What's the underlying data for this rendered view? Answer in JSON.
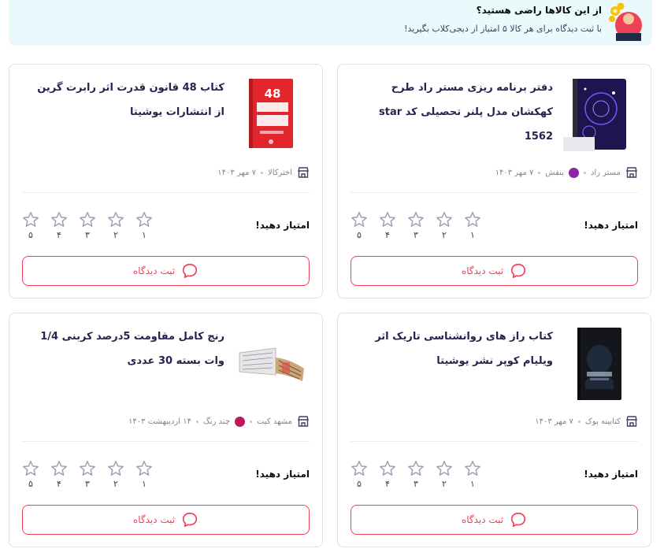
{
  "banner": {
    "title": "از این کالاها راضی هستید؟",
    "subtitle": "با ثبت دیدگاه برای هر کالا ۵ امتیاز از دیجی‌کلاب بگیرید!"
  },
  "rate_label": "امتیاز دهید!",
  "comment_label": "ثبت دیدگاه",
  "star_numbers": [
    "۱",
    "۲",
    "۳",
    "۴",
    "۵"
  ],
  "products": [
    {
      "title": "دفتر برنامه ریزی مستر راد طرح کهکشان مدل پلنر تحصیلی کد star 1562",
      "seller": "مستر راد",
      "color_name": "بنفش",
      "color_hex": "#8e24aa",
      "date": "۷ مهر ۱۴۰۳"
    },
    {
      "title": "کتاب 48 قانون قدرت اثر رابرت گرین از انتشارات یوشیتا",
      "seller": "اخترکالا",
      "date": "۷ مهر ۱۴۰۳"
    },
    {
      "title": "کتاب راز های روانشناسی تاریک اثر ویلیام کوپر نشر یوشیتا",
      "seller": "کتابینه بوک",
      "date": "۷ مهر ۱۴۰۳"
    },
    {
      "title": "رنج کامل مقاومت 5درصد کربنی 1/4 وات بسته 30 عددی",
      "seller": "مشهد کیت",
      "color_name": "چند رنگ",
      "color_hex": "#c2185b",
      "date": "۱۴ اردیبهشت ۱۴۰۳"
    }
  ],
  "colors": {
    "accent": "#ef4056",
    "banner_bg": "#eaf9fb",
    "star": "#9e9fb1"
  },
  "icons": [
    "shop-icon",
    "star-outline-icon",
    "comment-icon"
  ]
}
